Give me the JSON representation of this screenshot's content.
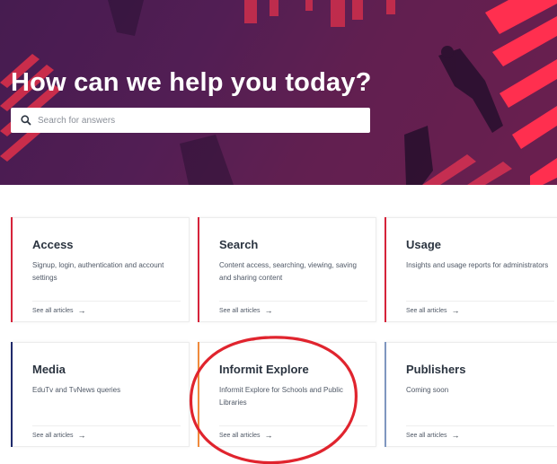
{
  "hero": {
    "title": "How can we help you today?",
    "search_placeholder": "Search for answers"
  },
  "cards": [
    {
      "title": "Access",
      "description": "Signup, login, authentication and account settings",
      "link": "See all articles",
      "accent": "#d6233a"
    },
    {
      "title": "Search",
      "description": "Content access, searching, viewing, saving and sharing content",
      "link": "See all articles",
      "accent": "#d6233a"
    },
    {
      "title": "Usage",
      "description": "Insights and usage reports for administrators",
      "link": "See all articles",
      "accent": "#d6233a"
    },
    {
      "title": "Media",
      "description": "EduTv and TvNews queries",
      "link": "See all articles",
      "accent": "#1f2a6b"
    },
    {
      "title": "Informit Explore",
      "description": "Informit Explore for Schools and Public Libraries",
      "link": "See all articles",
      "accent": "#f08a3c"
    },
    {
      "title": "Publishers",
      "description": "Coming soon",
      "link": "See all articles",
      "accent": "#7f97c0"
    }
  ],
  "annotation_color": "#e0242e"
}
